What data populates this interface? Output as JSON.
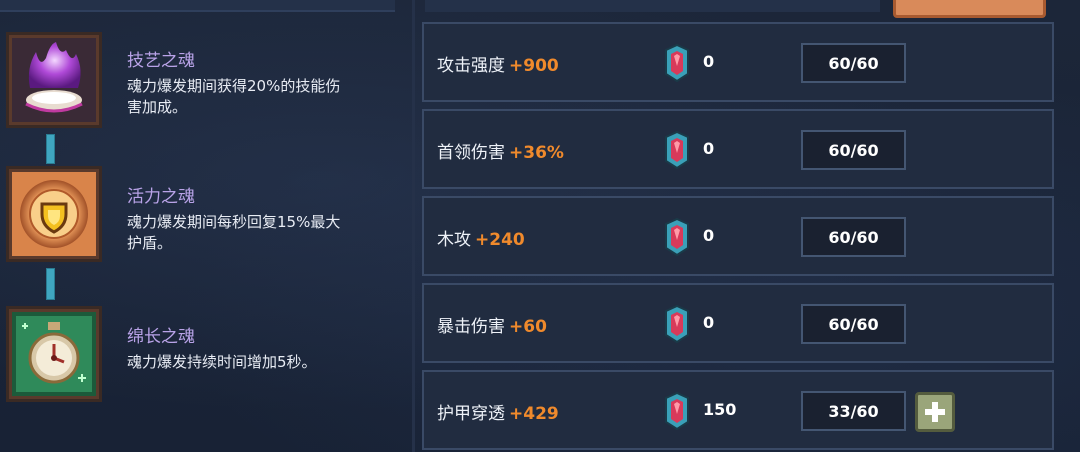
{
  "souls": [
    {
      "title": "技艺之魂",
      "desc_line1": "魂力爆发期间获得20%的技能伤",
      "desc_line2": "害加成。",
      "icon": "purple-flame-icon"
    },
    {
      "title": "活力之魂",
      "desc_line1": "魂力爆发期间每秒回复15%最大",
      "desc_line2": "护盾。",
      "icon": "golden-shield-icon"
    },
    {
      "title": "绵长之魂",
      "desc_line1": "魂力爆发持续时间增加5秒。",
      "desc_line2": "",
      "icon": "green-stopwatch-icon"
    }
  ],
  "stats": [
    {
      "name": "攻击强度",
      "bonus": "+900",
      "cost": "0",
      "level": "60/60",
      "can_upgrade": false
    },
    {
      "name": "首领伤害",
      "bonus": "+36%",
      "cost": "0",
      "level": "60/60",
      "can_upgrade": false
    },
    {
      "name": "木攻",
      "bonus": "+240",
      "cost": "0",
      "level": "60/60",
      "can_upgrade": false
    },
    {
      "name": "暴击伤害",
      "bonus": "+60",
      "cost": "0",
      "level": "60/60",
      "can_upgrade": false
    },
    {
      "name": "护甲穿透",
      "bonus": "+429",
      "cost": "150",
      "level": "33/60",
      "can_upgrade": true
    }
  ],
  "colors": {
    "bonus": "#f08a2c",
    "soul_title": "#b9a3e8",
    "connector": "#3fa6c0",
    "plus_button": "#9aa57a"
  }
}
